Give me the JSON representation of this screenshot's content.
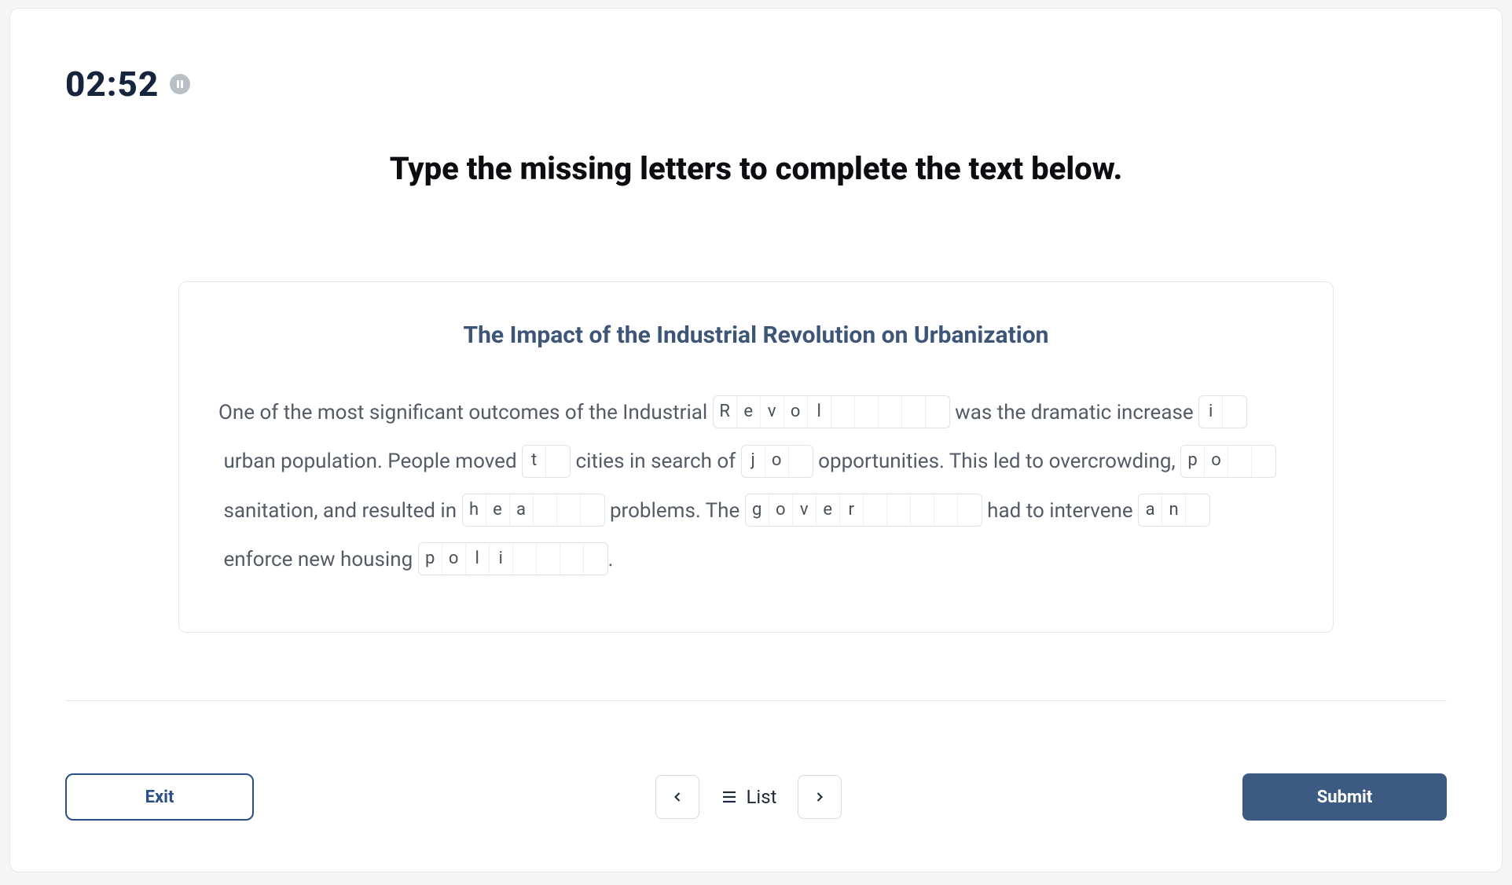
{
  "timer": "02:52",
  "instruction": "Type the missing letters to complete the text below.",
  "panel_title": "The Impact of the Industrial Revolution on Urbanization",
  "segments": [
    {
      "type": "text",
      "value": "One of the most significant outcomes of the Industrial "
    },
    {
      "type": "word",
      "letters": [
        "R",
        "e",
        "v",
        "o",
        "l",
        "",
        "",
        "",
        "",
        ""
      ]
    },
    {
      "type": "text",
      "value": " was the dramatic increase "
    },
    {
      "type": "word",
      "letters": [
        "i",
        ""
      ]
    },
    {
      "type": "text",
      "value": " urban population. People moved "
    },
    {
      "type": "word",
      "letters": [
        "t",
        ""
      ]
    },
    {
      "type": "text",
      "value": " cities in search of "
    },
    {
      "type": "word",
      "letters": [
        "j",
        "o",
        ""
      ]
    },
    {
      "type": "text",
      "value": " opportunities. This led to overcrowding, "
    },
    {
      "type": "word",
      "letters": [
        "p",
        "o",
        "",
        ""
      ]
    },
    {
      "type": "text",
      "value": " sanitation, and resulted in "
    },
    {
      "type": "word",
      "letters": [
        "h",
        "e",
        "a",
        "",
        "",
        ""
      ]
    },
    {
      "type": "text",
      "value": " problems. The "
    },
    {
      "type": "word",
      "letters": [
        "g",
        "o",
        "v",
        "e",
        "r",
        "",
        "",
        "",
        "",
        ""
      ]
    },
    {
      "type": "text",
      "value": " had to intervene "
    },
    {
      "type": "word",
      "letters": [
        "a",
        "n",
        ""
      ]
    },
    {
      "type": "text",
      "value": " enforce new housing "
    },
    {
      "type": "word",
      "letters": [
        "p",
        "o",
        "l",
        "i",
        "",
        "",
        "",
        ""
      ]
    },
    {
      "type": "text",
      "value": "."
    }
  ],
  "footer": {
    "exit": "Exit",
    "list": "List",
    "submit": "Submit"
  }
}
